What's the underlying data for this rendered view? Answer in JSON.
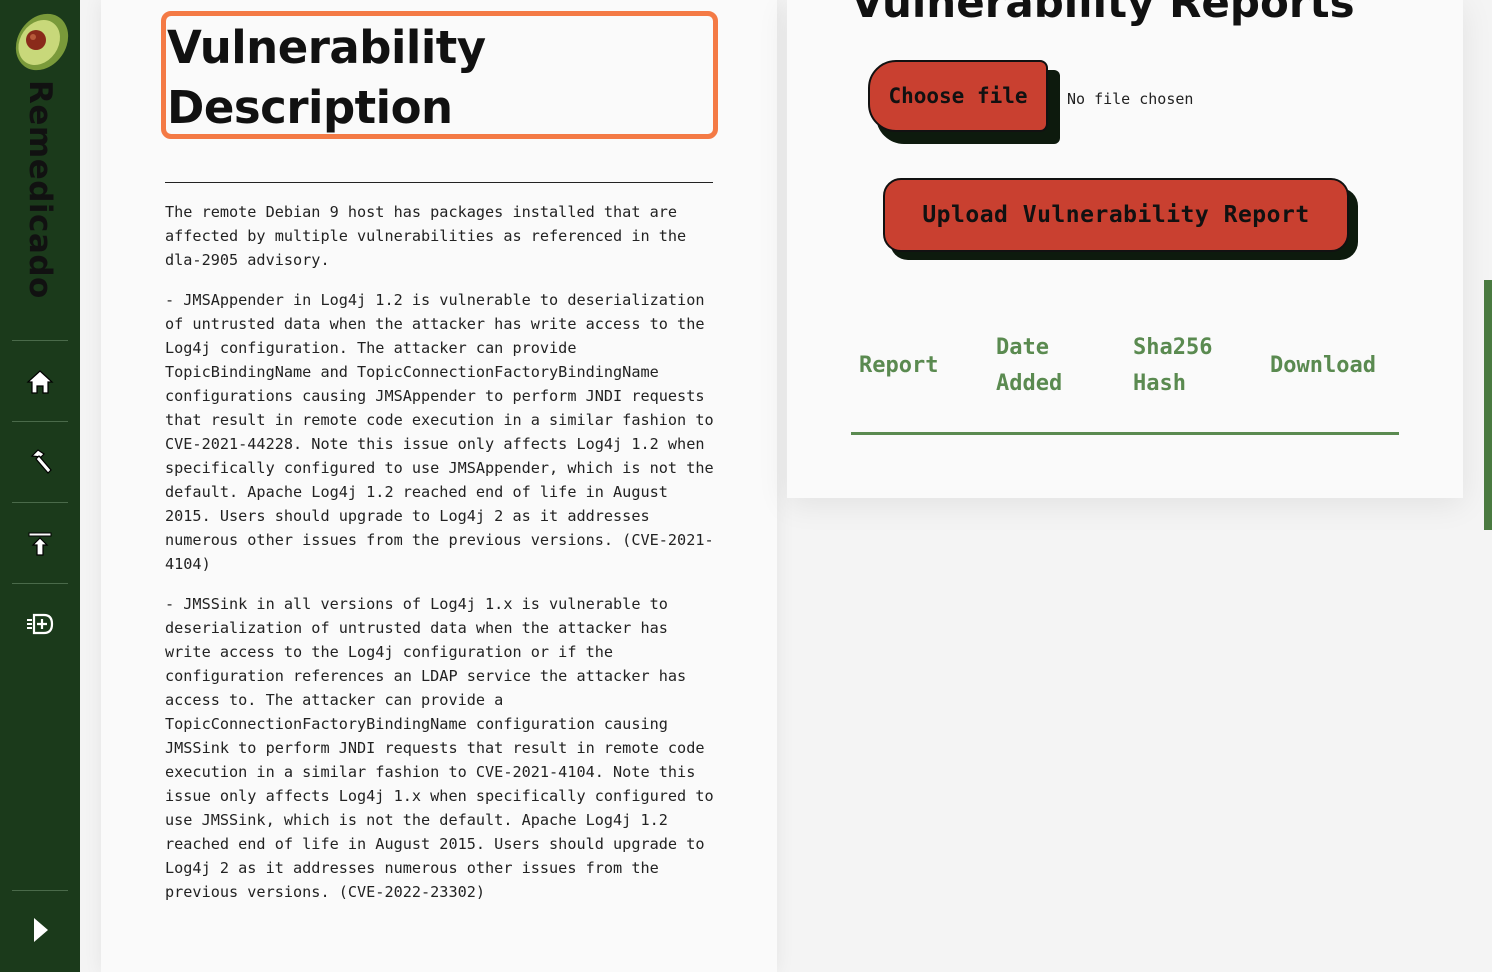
{
  "sidebar": {
    "brand": "Remedicado",
    "nav": [
      {
        "icon": "home-icon"
      },
      {
        "icon": "hammer-icon"
      },
      {
        "icon": "upload-icon"
      },
      {
        "icon": "add-report-icon"
      }
    ],
    "expand_icon": "chevron-right-icon"
  },
  "left_panel": {
    "title": "Vulnerability Description",
    "paragraphs": [
      "The remote Debian 9 host has packages installed that are affected by multiple vulnerabilities as referenced in the dla-2905 advisory.",
      "- JMSAppender in Log4j 1.2 is vulnerable to deserialization of untrusted data when the attacker has write access to the Log4j configuration. The attacker can provide TopicBindingName and TopicConnectionFactoryBindingName configurations causing JMSAppender to perform JNDI requests that result in remote code execution in a similar fashion to CVE-2021-44228. Note this issue only affects Log4j 1.2 when specifically configured to use JMSAppender, which is not the default. Apache Log4j 1.2 reached end of life in August 2015. Users should upgrade to Log4j 2 as it addresses numerous other issues from the previous versions. (CVE-2021-4104)",
      "- JMSSink in all versions of Log4j 1.x is vulnerable to deserialization of untrusted data when the attacker has write access to the Log4j configuration or if the configuration references an LDAP service the attacker has access to. The attacker can provide a TopicConnectionFactoryBindingName configuration causing JMSSink to perform JNDI requests that result in remote code execution in a similar fashion to CVE-2021-4104. Note this issue only affects Log4j 1.x when specifically configured to use JMSSink, which is not the default. Apache Log4j 1.2 reached end of life in August 2015. Users should upgrade to Log4j 2 as it addresses numerous other issues from the previous versions. (CVE-2022-23302)"
    ]
  },
  "right_panel": {
    "title": "Vulnerability Reports",
    "choose_file_label": "Choose file",
    "no_file_text": "No file chosen",
    "upload_label": "Upload Vulnerability Report",
    "columns": [
      {
        "line1": "Report",
        "line2": ""
      },
      {
        "line1": "Date",
        "line2": "Added"
      },
      {
        "line1": "Sha256",
        "line2": "Hash"
      },
      {
        "line1": "Download",
        "line2": ""
      }
    ]
  },
  "colors": {
    "sidebar": "#1b3a1b",
    "accent_red": "#c94030",
    "highlight_orange": "#f47a45",
    "table_green": "#5a8a50"
  }
}
